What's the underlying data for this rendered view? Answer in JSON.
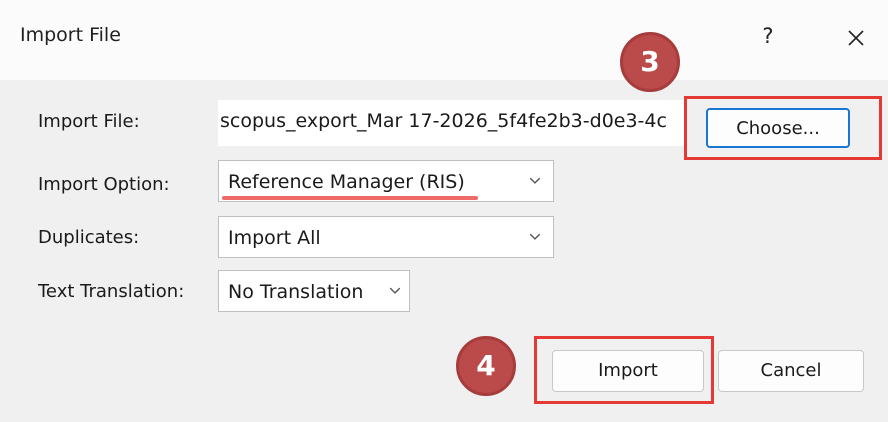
{
  "dialog": {
    "title": "Import File",
    "help_glyph": "?",
    "close_icon": "close-icon"
  },
  "fields": {
    "import_file": {
      "label": "Import File:",
      "value": "scopus_export_Mar 17-2026_5f4fe2b3-d0e3-4c",
      "button_label": "Choose..."
    },
    "import_option": {
      "label": "Import Option:",
      "value": "Reference Manager (RIS)"
    },
    "duplicates": {
      "label": "Duplicates:",
      "value": "Import All"
    },
    "text_translation": {
      "label": "Text Translation:",
      "value": "No Translation"
    }
  },
  "actions": {
    "import_label": "Import",
    "cancel_label": "Cancel"
  },
  "annotations": {
    "step_choose": "3",
    "step_import": "4",
    "highlight_color": "#e53935",
    "badge_color": "#bb4a4a",
    "underline_color": "#ee6a67"
  }
}
